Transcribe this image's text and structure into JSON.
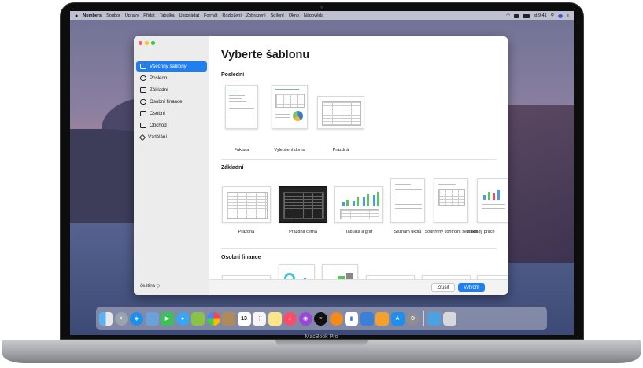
{
  "menubar": {
    "app": "Numbers",
    "items": [
      "Soubor",
      "Úpravy",
      "Přidat",
      "Tabulka",
      "Uspořádat",
      "Formát",
      "Rozložení",
      "Zobrazení",
      "Sdílení",
      "Okno",
      "Nápověda"
    ],
    "clock": "st 9:41"
  },
  "sidebar": {
    "items": [
      {
        "label": "Všechny šablony",
        "icon": "templates-icon"
      },
      {
        "label": "Poslední",
        "icon": "clock-icon"
      },
      {
        "label": "Základní",
        "icon": "table-icon"
      },
      {
        "label": "Osobní finance",
        "icon": "piggy-bank-icon"
      },
      {
        "label": "Osobní",
        "icon": "house-icon"
      },
      {
        "label": "Obchod",
        "icon": "briefcase-icon"
      },
      {
        "label": "Vzdělání",
        "icon": "graduation-cap-icon"
      }
    ],
    "language": "čeština ◇"
  },
  "main": {
    "title": "Vyberte šablonu",
    "sections": {
      "recent": {
        "label": "Poslední",
        "items": [
          "Faktura",
          "Vylepšení domu",
          "Prázdná"
        ]
      },
      "basic": {
        "label": "Základní",
        "items": [
          "Prázdná",
          "Prázdná černá",
          "Tabulka a graf",
          "Seznam úkolů",
          "Souhrnný kontrolní seznam",
          "Základy práce"
        ]
      },
      "finance": {
        "label": "Osobní finance"
      }
    }
  },
  "footer": {
    "cancel": "Zrušit",
    "create": "Vytvořit"
  },
  "laptop": {
    "brand": "MacBook Pro"
  },
  "colors": {
    "accent": "#1f7ef0",
    "sidebar_bg": "#ececec"
  }
}
